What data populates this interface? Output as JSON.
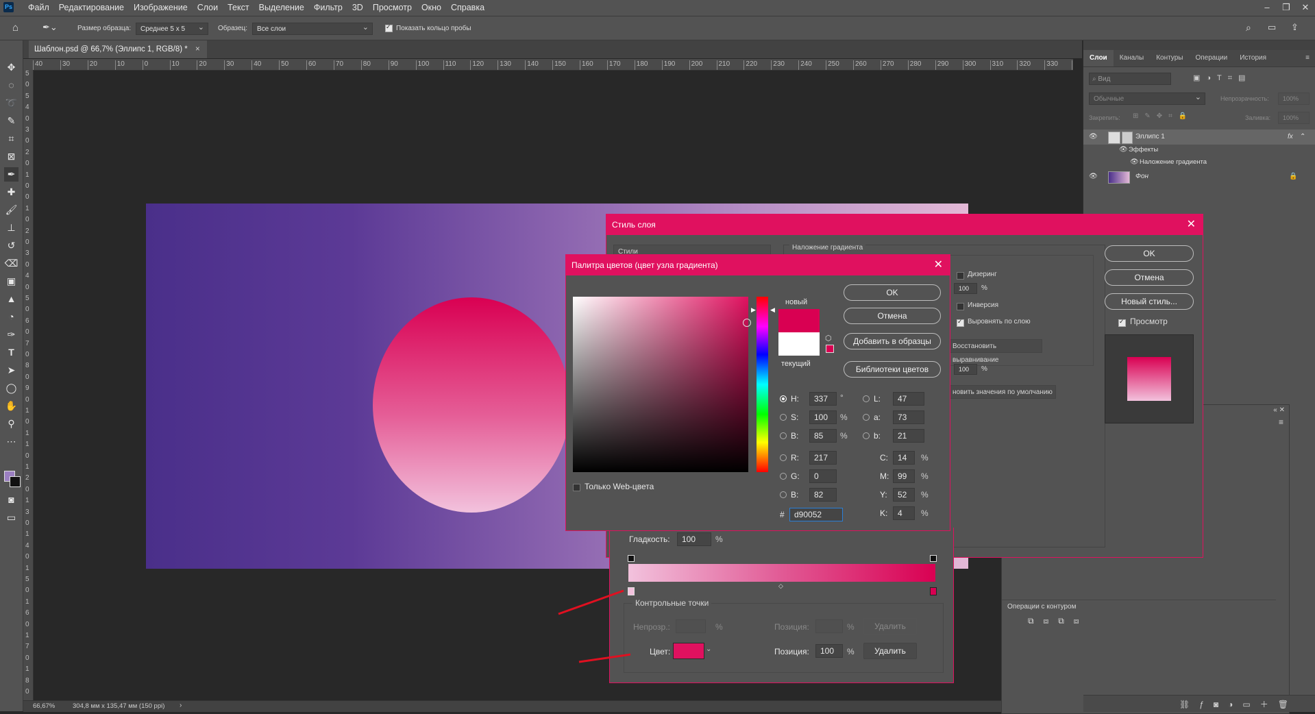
{
  "menubar": {
    "logo": "Ps",
    "items": [
      "Файл",
      "Редактирование",
      "Изображение",
      "Слои",
      "Текст",
      "Выделение",
      "Фильтр",
      "3D",
      "Просмотр",
      "Окно",
      "Справка"
    ]
  },
  "options": {
    "sample_size_label": "Размер образца:",
    "sample_size_value": "Среднее 5 x 5",
    "sample_label": "Образец:",
    "sample_value": "Все слои",
    "ring_label": "Показать кольцо пробы"
  },
  "document": {
    "tab_title": "Шаблон.psd @ 66,7% (Эллипс 1, RGB/8) *",
    "ruler_h": [
      "40",
      "30",
      "20",
      "10",
      "0",
      "10",
      "20",
      "30",
      "40",
      "50",
      "60",
      "70",
      "80",
      "90",
      "100",
      "110",
      "120",
      "130",
      "140",
      "150",
      "160",
      "170",
      "180",
      "190",
      "200",
      "210",
      "220",
      "230",
      "240",
      "250",
      "260",
      "270",
      "280",
      "290",
      "300",
      "310",
      "320",
      "330",
      "34"
    ],
    "ruler_v": [
      "5",
      "0",
      "5",
      "4",
      "0",
      "3",
      "0",
      "2",
      "0",
      "1",
      "0",
      "0",
      "1",
      "0",
      "2",
      "0",
      "3",
      "0",
      "4",
      "0",
      "5",
      "0",
      "6",
      "0",
      "7",
      "0",
      "8",
      "0",
      "9",
      "0",
      "1",
      "0",
      "1",
      "1",
      "0",
      "1",
      "2",
      "0",
      "1",
      "3",
      "0",
      "1",
      "4",
      "0",
      "1",
      "5",
      "0",
      "1",
      "6",
      "0",
      "1",
      "7",
      "0",
      "1",
      "8",
      "0"
    ],
    "zoom": "66,67%",
    "doc_info": "304,8 мм x 135,47 мм (150 ppi)"
  },
  "layers_panel": {
    "tabs": [
      "Слои",
      "Каналы",
      "Контуры",
      "Операции",
      "История"
    ],
    "search_placeholder": "Вид",
    "blend_mode": "Обычные",
    "opacity_label": "Непрозрачность:",
    "opacity_value": "100%",
    "lock_label": "Закрепить:",
    "fill_label": "Заливка:",
    "fill_value": "100%",
    "layers": [
      {
        "name": "Эллипс 1",
        "fx": "fx"
      },
      {
        "name": "Эффекты"
      },
      {
        "name": "Наложение градиента"
      },
      {
        "name": "Фон"
      }
    ],
    "path_ops_label": "Операции с контуром"
  },
  "layer_style": {
    "title": "Стиль слоя",
    "styles_label": "Стили",
    "section": "Наложение градиента",
    "dither": "Дизеринг",
    "opacity_value": "100",
    "reverse": "Инверсия",
    "align": "Выровнять по слою",
    "reset_align": "Восстановить выравнивание",
    "scale_value": "100",
    "reset_defaults": "новить значения по умолчанию",
    "ok": "OK",
    "cancel": "Отмена",
    "new_style": "Новый стиль...",
    "preview": "Просмотр",
    "pct": "%"
  },
  "gradient_editor": {
    "smooth_label": "Гладкость:",
    "smooth_value": "100",
    "stops_title": "Контрольные точки",
    "opacity_label": "Непрозр.:",
    "position_label": "Позиция:",
    "delete": "Удалить",
    "color_label": "Цвет:",
    "color_position": "100",
    "pct": "%"
  },
  "color_picker": {
    "title": "Палитра цветов (цвет узла градиента)",
    "new_label": "новый",
    "current_label": "текущий",
    "ok": "OK",
    "cancel": "Отмена",
    "add_swatch": "Добавить в образцы",
    "libraries": "Библиотеки цветов",
    "web_only": "Только Web-цвета",
    "H": "337",
    "S": "100",
    "B": "85",
    "R": "217",
    "G": "0",
    "Bb": "82",
    "L": "47",
    "a": "73",
    "b": "21",
    "C": "14",
    "M": "99",
    "Y": "52",
    "K": "4",
    "hex": "d90052",
    "lbl_H": "H:",
    "lbl_S": "S:",
    "lbl_B": "B:",
    "lbl_R": "R:",
    "lbl_G": "G:",
    "lbl_Bb": "B:",
    "lbl_L": "L:",
    "lbl_a": "a:",
    "lbl_b": "b:",
    "lbl_C": "C:",
    "lbl_M": "M:",
    "lbl_Y": "Y:",
    "lbl_K": "K:",
    "deg": "°",
    "pct": "%",
    "hash": "#"
  },
  "colors": {
    "accent": "#e0115f",
    "new_color": "#d90052",
    "current_color": "#ffffff"
  }
}
